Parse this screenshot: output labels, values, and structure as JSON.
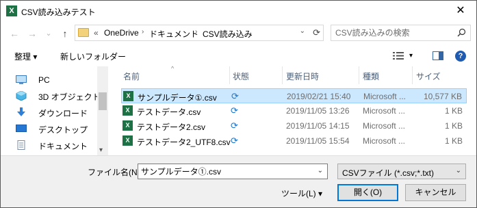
{
  "window": {
    "title": "CSV読み込みテスト",
    "close": "✕"
  },
  "nav": {
    "back": "←",
    "forward": "→",
    "recent": "⌄",
    "up": "↑",
    "breadcrumb": [
      "«",
      "OneDrive",
      "ドキュメント",
      "CSV読み込み"
    ],
    "separator": "›",
    "search_placeholder": "CSV読み込みの検索"
  },
  "toolbar": {
    "organize": "整理 ▾",
    "new_folder": "新しいフォルダー",
    "view_chevron": "▾",
    "help": "?"
  },
  "sidebar": {
    "items": [
      {
        "label": "PC",
        "icon": "pc-icon"
      },
      {
        "label": "3D オブジェクト",
        "icon": "3d-objects-icon"
      },
      {
        "label": "ダウンロード",
        "icon": "download-icon"
      },
      {
        "label": "デスクトップ",
        "icon": "desktop-icon"
      },
      {
        "label": "ドキュメント",
        "icon": "document-icon"
      }
    ],
    "scroll_down": "▾"
  },
  "list": {
    "columns": [
      "名前",
      "状態",
      "更新日時",
      "種類",
      "サイズ"
    ],
    "sort_indicator": "^",
    "rows": [
      {
        "name": "サンプルデータ①.csv",
        "date": "2019/02/21 15:40",
        "type": "Microsoft ...",
        "size": "10,577 KB",
        "selected": true
      },
      {
        "name": "テストデータ.csv",
        "date": "2019/11/05 13:26",
        "type": "Microsoft ...",
        "size": "1 KB",
        "selected": false
      },
      {
        "name": "テストデータ2.csv",
        "date": "2019/11/05 14:15",
        "type": "Microsoft ...",
        "size": "1 KB",
        "selected": false
      },
      {
        "name": "テストデータ2_UTF8.csv",
        "date": "2019/11/05 15:54",
        "type": "Microsoft ...",
        "size": "1 KB",
        "selected": false
      }
    ],
    "sync_glyph": "⟳",
    "excel_glyph": "X"
  },
  "footer": {
    "filename_label": "ファイル名(N):",
    "filename_value": "サンプルデータ①.csv",
    "filter_label": "CSVファイル (*.csv;*.txt)",
    "tools": "ツール(L) ▾",
    "open": "開く(O)",
    "cancel": "キャンセル"
  },
  "colors": {
    "accent": "#0078d7",
    "selection": "#cce8ff",
    "excel": "#1e7145",
    "sync": "#1a73c9"
  }
}
